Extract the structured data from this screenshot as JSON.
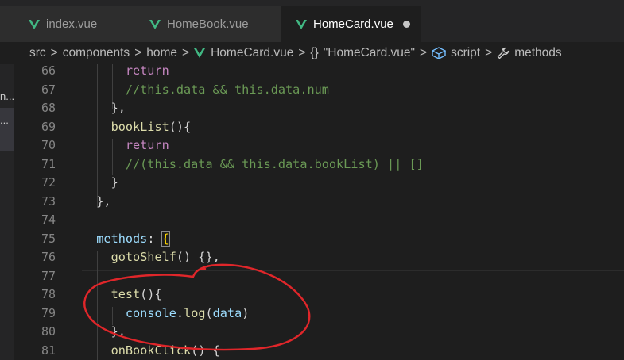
{
  "tabs": [
    {
      "label": "index.vue",
      "active": false
    },
    {
      "label": "HomeBook.vue",
      "active": false
    },
    {
      "label": "HomeCard.vue",
      "active": true,
      "dirty": true
    }
  ],
  "breadcrumb": {
    "items": [
      "src",
      "components",
      "home",
      "HomeCard.vue",
      "\"HomeCard.vue\"",
      "script",
      "methods"
    ],
    "separator": ">",
    "braces_symbol": "{}"
  },
  "sidebar": {
    "labels": [
      "n...",
      "..."
    ]
  },
  "editor": {
    "lines": [
      {
        "num": "66",
        "tokens": [
          {
            "t": "      ",
            "c": "pn"
          },
          {
            "t": "return",
            "c": "kw"
          }
        ]
      },
      {
        "num": "67",
        "tokens": [
          {
            "t": "      ",
            "c": "pn"
          },
          {
            "t": "//this.data && this.data.num",
            "c": "cm"
          }
        ]
      },
      {
        "num": "68",
        "tokens": [
          {
            "t": "    },",
            "c": "pn"
          }
        ]
      },
      {
        "num": "69",
        "tokens": [
          {
            "t": "    ",
            "c": "pn"
          },
          {
            "t": "bookList",
            "c": "fn"
          },
          {
            "t": "(){",
            "c": "pn"
          }
        ]
      },
      {
        "num": "70",
        "tokens": [
          {
            "t": "      ",
            "c": "pn"
          },
          {
            "t": "return",
            "c": "kw"
          }
        ]
      },
      {
        "num": "71",
        "tokens": [
          {
            "t": "      ",
            "c": "pn"
          },
          {
            "t": "//(this.data && this.data.bookList) || []",
            "c": "cm"
          }
        ]
      },
      {
        "num": "72",
        "tokens": [
          {
            "t": "    }",
            "c": "pn"
          }
        ]
      },
      {
        "num": "73",
        "tokens": [
          {
            "t": "  },",
            "c": "pn"
          }
        ]
      },
      {
        "num": "74",
        "tokens": []
      },
      {
        "num": "75",
        "tokens": [
          {
            "t": "  ",
            "c": "pn"
          },
          {
            "t": "methods",
            "c": "va"
          },
          {
            "t": ": ",
            "c": "pn"
          },
          {
            "t": "{",
            "c": "br box"
          }
        ]
      },
      {
        "num": "76",
        "tokens": [
          {
            "t": "    ",
            "c": "pn"
          },
          {
            "t": "gotoShelf",
            "c": "fn"
          },
          {
            "t": "() {},",
            "c": "pn"
          }
        ]
      },
      {
        "num": "77",
        "tokens": []
      },
      {
        "num": "78",
        "tokens": [
          {
            "t": "    ",
            "c": "pn"
          },
          {
            "t": "test",
            "c": "fn"
          },
          {
            "t": "(){",
            "c": "pn"
          }
        ]
      },
      {
        "num": "79",
        "tokens": [
          {
            "t": "      ",
            "c": "pn"
          },
          {
            "t": "console",
            "c": "va"
          },
          {
            "t": ".",
            "c": "pn"
          },
          {
            "t": "log",
            "c": "fn"
          },
          {
            "t": "(",
            "c": "pn"
          },
          {
            "t": "data",
            "c": "va"
          },
          {
            "t": ")",
            "c": "pn"
          }
        ]
      },
      {
        "num": "80",
        "tokens": [
          {
            "t": "    },",
            "c": "pn"
          }
        ]
      },
      {
        "num": "81",
        "tokens": [
          {
            "t": "    ",
            "c": "pn"
          },
          {
            "t": "onBookClick",
            "c": "fn"
          },
          {
            "t": "() {",
            "c": "pn"
          }
        ]
      }
    ]
  },
  "colors": {
    "vue_green": "#41b883",
    "annotation_red": "#e0262a",
    "keyword": "#c586c0",
    "comment": "#6a9955",
    "function": "#dcdcaa",
    "variable": "#9cdcfe"
  },
  "icons": [
    "vue-file-icon",
    "braces-icon",
    "cube-icon",
    "wrench-icon",
    "dirty-dot-icon"
  ]
}
